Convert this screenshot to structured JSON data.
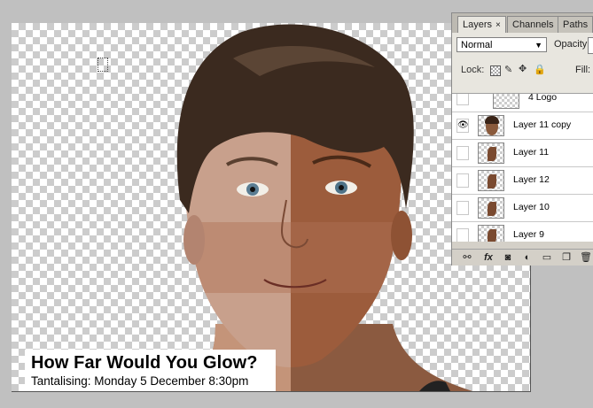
{
  "canvas": {
    "caption_line1": "How Far Would You Glow?",
    "caption_line2": "Tantalising: Monday 5 December 8:30pm"
  },
  "layers_panel": {
    "tabs": [
      {
        "label": "Layers",
        "active": true,
        "close": "×"
      },
      {
        "label": "Channels",
        "active": false
      },
      {
        "label": "Paths",
        "active": false
      }
    ],
    "blend_mode": "Normal",
    "opacity_label": "Opacity:",
    "lock_label": "Lock:",
    "fill_label": "Fill:",
    "eye_glyph": "👁",
    "layers": [
      {
        "name": "4 Logo",
        "visible": false,
        "thumb": "transparent"
      },
      {
        "name": "Layer 11 copy",
        "visible": true,
        "thumb": "face"
      },
      {
        "name": "Layer 11",
        "visible": false,
        "thumb": "fragment"
      },
      {
        "name": "Layer 12",
        "visible": false,
        "thumb": "fragment"
      },
      {
        "name": "Layer 10",
        "visible": false,
        "thumb": "fragment"
      },
      {
        "name": "Layer 9",
        "visible": false,
        "thumb": "fragment"
      }
    ],
    "bottom_icons": [
      "link-icon",
      "fx-icon",
      "mask-icon",
      "adjustment-icon",
      "group-folder-icon",
      "new-layer-icon",
      "trash-icon"
    ],
    "bottom_glyphs": {
      "fx": "fx"
    }
  },
  "colors": {
    "panel_bg": "#d4d0c8",
    "workspace_bg": "#c0c0c0",
    "checker": "#cccccc"
  }
}
